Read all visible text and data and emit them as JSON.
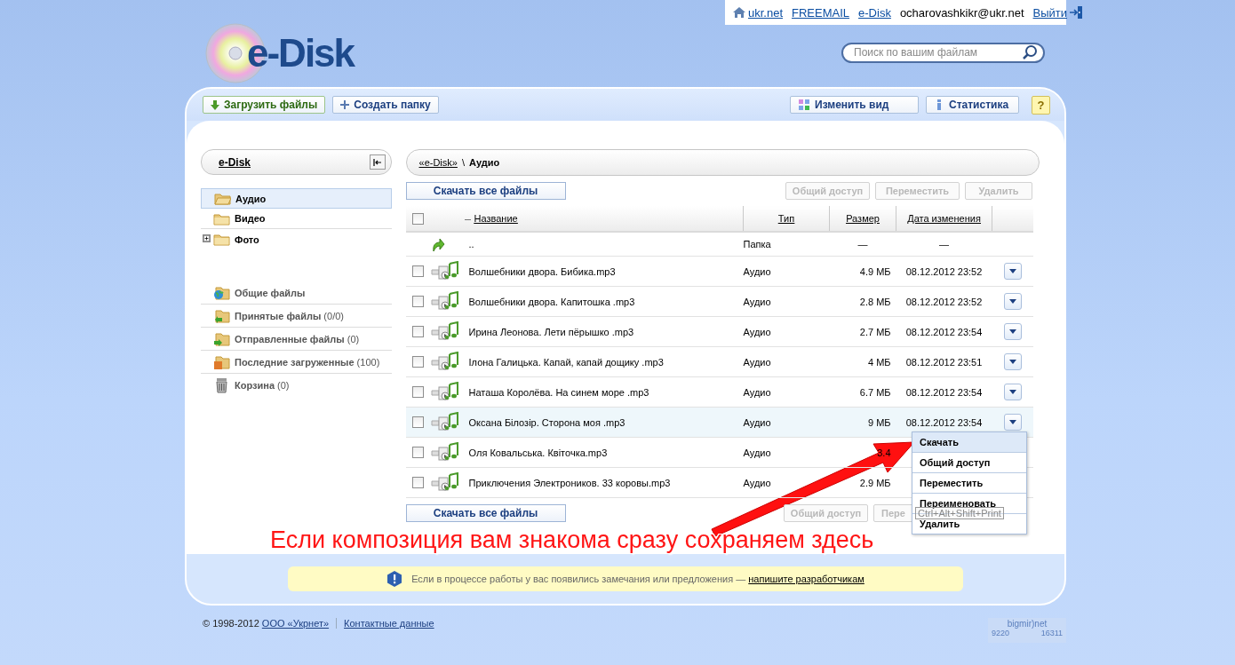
{
  "top_bar": {
    "links": [
      {
        "text": "ukr.net",
        "kind": "home"
      },
      {
        "text": "FREEMAIL",
        "kind": "plain"
      },
      {
        "text": "e-Disk",
        "kind": "plain"
      }
    ],
    "user": "ocharovashkikr@ukr.net",
    "logout": "Выйти"
  },
  "logo": {
    "text": "e-Disk"
  },
  "search": {
    "placeholder": "Поиск по вашим файлам"
  },
  "toolbar": {
    "left": [
      {
        "label": "Загрузить файлы",
        "kind": "upload"
      },
      {
        "label": "Создать папку",
        "kind": "folder"
      }
    ],
    "right": [
      {
        "label": "Изменить вид",
        "kind": "view"
      },
      {
        "label": "Статистика",
        "kind": "stats"
      }
    ],
    "help": "?"
  },
  "sidebar": {
    "title": "e-Disk",
    "folders": [
      {
        "label": "Аудио",
        "selected": true,
        "expandable": false
      },
      {
        "label": "Видео",
        "selected": false,
        "expandable": false
      },
      {
        "label": "Фото",
        "selected": false,
        "expandable": true
      }
    ],
    "sections": [
      {
        "label": "Общие файлы",
        "kind": "shared"
      },
      {
        "label": "Принятые файлы",
        "count": "(0/0)",
        "kind": "received"
      },
      {
        "label": "Отправленные файлы",
        "count": "(0)",
        "kind": "sent"
      },
      {
        "label": "Последние загруженные",
        "count": "(100)",
        "kind": "recent"
      },
      {
        "label": "Корзина",
        "count": "(0)",
        "kind": "trash"
      }
    ]
  },
  "breadcrumb": {
    "items": [
      {
        "text": "«e-Disk»",
        "kind": "link"
      },
      {
        "text": "Аудио",
        "kind": "current"
      }
    ],
    "separator": "\\"
  },
  "actions_top": {
    "download_all": "Скачать все файлы",
    "buttons": [
      {
        "label": "Общий доступ",
        "disabled": true
      },
      {
        "label": "Переместить",
        "disabled": true
      },
      {
        "label": "Удалить",
        "disabled": true
      }
    ]
  },
  "table": {
    "columns": [
      {
        "label": "Название",
        "sorted": true
      },
      {
        "label": "Тип",
        "sorted": false
      },
      {
        "label": "Размер",
        "sorted": false
      },
      {
        "label": "Дата изменения",
        "sorted": false
      }
    ],
    "select_all_checked": false,
    "parent_row": {
      "name": "..",
      "type": "Папка",
      "size": "—",
      "date": "—"
    },
    "rows": [
      {
        "name": "Волшебники двора. Бибика.mp3",
        "type": "Аудио",
        "size": "4.9 МБ",
        "date": "08.12.2012 23:52",
        "checked": false,
        "selected": false
      },
      {
        "name": "Волшебники двора. Капитошка .mp3",
        "type": "Аудио",
        "size": "2.8 МБ",
        "date": "08.12.2012 23:52",
        "checked": false,
        "selected": false
      },
      {
        "name": "Ирина Леонова. Лети пёрышко .mp3",
        "type": "Аудио",
        "size": "2.7 МБ",
        "date": "08.12.2012 23:54",
        "checked": false,
        "selected": false
      },
      {
        "name": "Ілона Галицька. Капай, капай дощику .mp3",
        "type": "Аудио",
        "size": "4 МБ",
        "date": "08.12.2012 23:51",
        "checked": false,
        "selected": false
      },
      {
        "name": "Наташа Королёва. На синем море .mp3",
        "type": "Аудио",
        "size": "6.7 МБ",
        "date": "08.12.2012 23:54",
        "checked": false,
        "selected": false
      },
      {
        "name": "Оксана Білозір. Сторона моя .mp3",
        "type": "Аудио",
        "size": "9 МБ",
        "date": "08.12.2012 23:54",
        "checked": false,
        "selected": true
      },
      {
        "name": "Оля Ковальська. Квіточка.mp3",
        "type": "Аудио",
        "size": "3.4",
        "checked": false,
        "selected": false
      },
      {
        "name": "Приключения Электроников. 33 коровы.mp3",
        "type": "Аудио",
        "size": "2.9 МБ",
        "checked": false,
        "selected": false
      }
    ]
  },
  "actions_bottom": {
    "download_all": "Скачать все файлы",
    "buttons": [
      {
        "label": "Общий доступ",
        "disabled": true
      },
      {
        "label": "Пере",
        "disabled": true
      }
    ]
  },
  "context_menu": {
    "items": [
      {
        "label": "Скачать",
        "selected": true
      },
      {
        "label": "Общий доступ",
        "selected": false
      },
      {
        "label": "Переместить",
        "selected": false
      },
      {
        "label": "Переименовать",
        "selected": false
      },
      {
        "label": "Удалить",
        "selected": false
      }
    ]
  },
  "tooltip": "Ctrl+Alt+Shift+Print",
  "annotation": "Если композиция вам знакома сразу сохраняем здесь",
  "notice": {
    "text": "Если в процессе работы у вас появились замечания или предложения —",
    "link": "напишите разработчикам"
  },
  "footer": {
    "copyright": "© 1998-2012",
    "company": "ООО «Укрнет»",
    "contacts": "Контактные данные"
  },
  "counter": {
    "brand": "bigmir)net",
    "values": [
      "9220",
      "16311"
    ]
  }
}
